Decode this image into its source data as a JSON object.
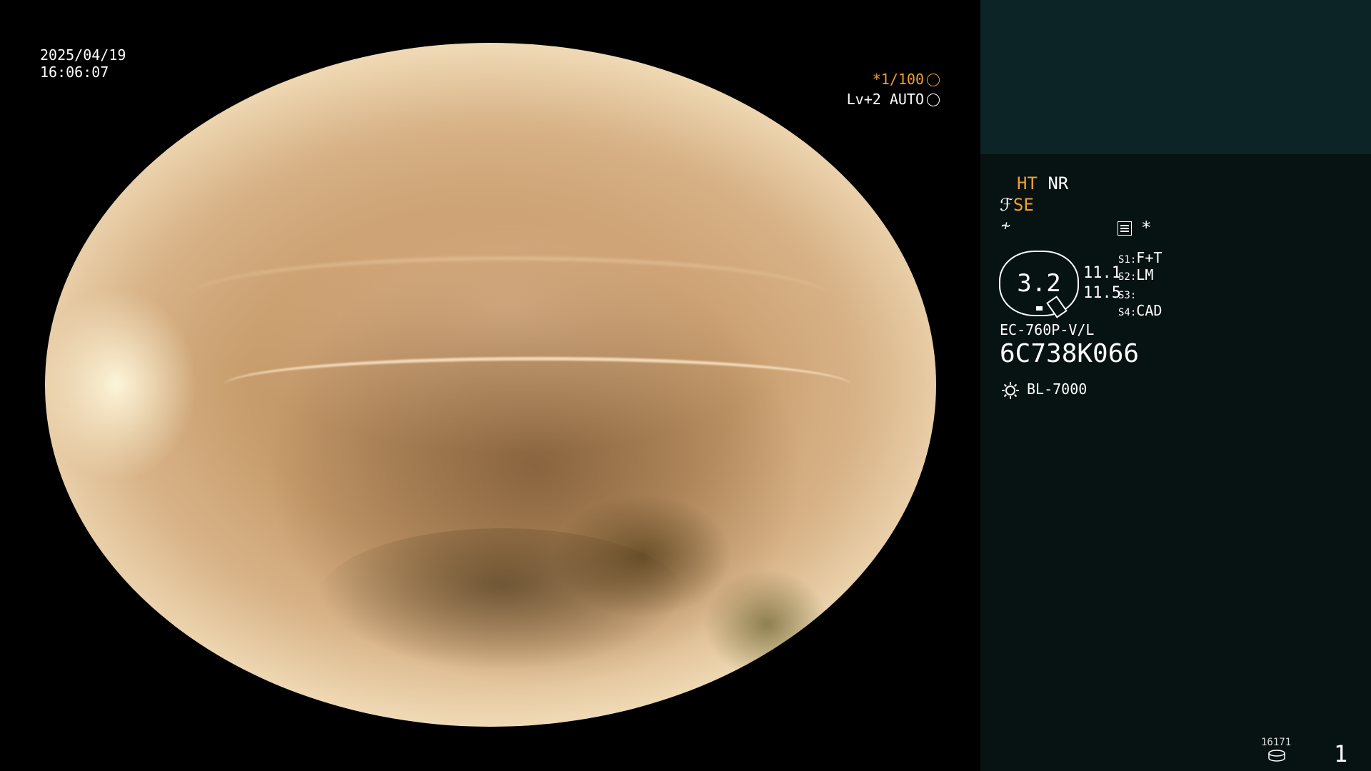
{
  "overlay": {
    "date": "2025/04/19",
    "time": "16:06:07",
    "shutter": "*1/100",
    "level": "Lv+2 AUTO"
  },
  "panel": {
    "ht": "HT",
    "nr": "NR",
    "se": "SE",
    "zoom": "3.2",
    "value_1": "11.1",
    "value_2": "11.5",
    "s1_key": "S1:",
    "s1_value": "F+T",
    "s2_key": "S2:",
    "s2_value": "LM",
    "s3_key": "S3:",
    "s3_value": "",
    "s4_key": "S4:",
    "s4_value": "CAD",
    "scope_model": "EC-760P-V/L",
    "serial": "6C738K066",
    "light_source": "BL-7000",
    "record_count": "16171",
    "page_number": "1"
  },
  "colors": {
    "accent_orange": "#f0a030",
    "panel_bg": "#071212",
    "panel_top_bg": "#0c2426"
  }
}
